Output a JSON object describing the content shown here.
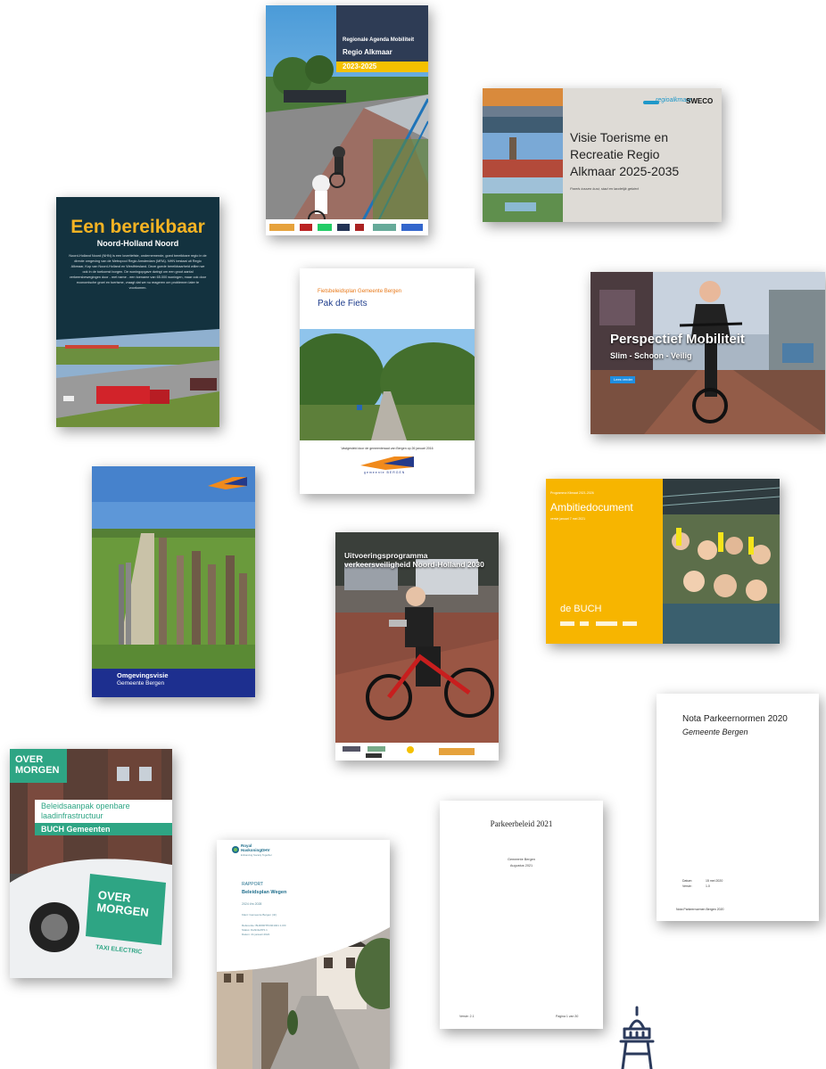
{
  "cards": {
    "regionale_agenda": {
      "kicker": "Regionale Agenda Mobiliteit",
      "title": "Regio Alkmaar",
      "years": "2023-2025"
    },
    "visie_toerisme": {
      "brand": "regioalkmaar",
      "partner": "SWECO",
      "title": "Visie Toerisme en\nRecreatie Regio\nAlkmaar 2025-2035",
      "subtitle": "Parels tussen kust, stad en landelijk gebied"
    },
    "bereikbaar": {
      "title": "Een bereikbaar",
      "subtitle": "Noord-Holland Noord",
      "body": "Noord-Holland Noord (NHN) is een lovertiefste, ondernemende, goed bereikbare regio in de directe omgeving van de Metropool Regio Amsterdam (MRA). NHN bestaat uit Regio Alkmaar, Kop van Noord-Holland en Westfriesland. Deze goede bereikbaarheid willen we ook in de toekomst borgen. De woningopgave dwingt om een groot aantal verkeersbewegingen door - met name - een toename van 65.000 woningen, maar ook door economische groei en toerisme, vraagt dat we nu reageren om problemen later te voorkomen."
    },
    "pak_de_fiets": {
      "kicker": "Fietsbeleidsplan Gemeente Bergen",
      "title": "Pak de Fiets",
      "caption": "Vastgesteld door de gemeenteraad van Bergen op 26 januari 2016",
      "logo_text": "gemeente BERGEN"
    },
    "perspectief": {
      "title": "Perspectief Mobiliteit",
      "subtitle": "Slim - Schoon - Veilig",
      "button": "Lees verder"
    },
    "omgevingsvisie": {
      "title": "Omgevingsvisie",
      "subtitle": "Gemeente Bergen"
    },
    "uitvoeringsprogramma": {
      "title": "Uitvoeringsprogramma\nverkeersveiligheid Noord-Holland 2030"
    },
    "ambitiedocument": {
      "kicker": "Programma Klimaat 2021-2026",
      "title": "Ambitiedocument",
      "date": "versie januari 7 mei 2021",
      "brand": "de BUCH"
    },
    "nota_parkeer": {
      "title": "Nota Parkeernormen 2020",
      "subtitle": "Gemeente Bergen",
      "meta_label_1": "Datum:",
      "meta_value_1": "15 mei 2020",
      "meta_label_2": "Versie:",
      "meta_value_2": "1.0",
      "footer": "Nota Parkeernormen Bergen 2020"
    },
    "overmorgen": {
      "brand": "OVER\nMORGEN",
      "title": "Beleidsaanpak openbare\nlaadinfrastructuur",
      "subtitle": "BUCH Gemeenten",
      "car_text": "OVER\nMORGEN",
      "car_sub": "TAXI ELECTRIC"
    },
    "royal": {
      "brand": "Royal\nHaskoningDHV",
      "tagline": "Enhancing Society Together",
      "label": "RAPPORT",
      "title": "Beleidsplan Wegen",
      "years": "2024 t/m 2028",
      "meta_1": "Klant:      Gemeente Bergen (nh)",
      "meta_2": "Referentie: BH3690TP2401021 1.0/0",
      "meta_3": "Status:     Definitief/P1.1",
      "meta_4": "Datum:      21 januari 2024"
    },
    "parkeerbeleid": {
      "title": "Parkeerbeleid 2021",
      "org": "Gemeente Bergen",
      "date": "Augustus 2021",
      "version": "Versie: 2.1",
      "page": "Pagina 1 van 30"
    }
  },
  "colors": {
    "navy": "#2e3c55",
    "yellow": "#f5c100",
    "dark_teal": "#13323f",
    "orange_yellow": "#f7b500",
    "blue_band": "#1d2f8f",
    "overmorgen_green": "#2ea584"
  },
  "icons": [
    "lighthouse-icon"
  ]
}
